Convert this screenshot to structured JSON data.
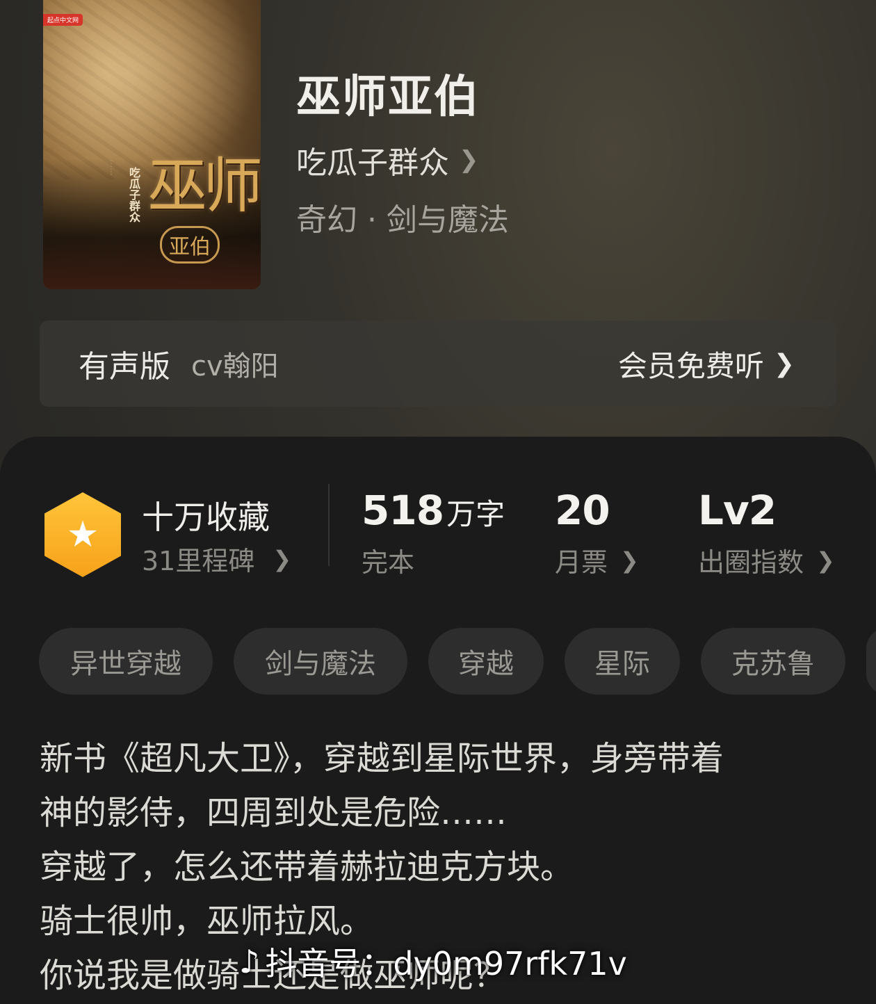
{
  "book": {
    "cover_badge": "起点中文网",
    "cover_title_big": "巫师",
    "cover_title_small": "亚伯",
    "cover_author": "吃瓜子群众",
    "title": "巫师亚伯",
    "author": "吃瓜子群众",
    "genre": "奇幻 · 剑与魔法"
  },
  "audio": {
    "label": "有声版",
    "narrator": "cv翰阳",
    "action": "会员免费听"
  },
  "stats": {
    "collect_title": "十万收藏",
    "collect_sub": "31里程碑",
    "words_number": "518",
    "words_unit": "万字",
    "status": "完本",
    "votes_number": "20",
    "votes_label": "月票",
    "level_number": "Lv2",
    "level_label": "出圈指数"
  },
  "tags": [
    "异世穿越",
    "剑与魔法",
    "穿越",
    "星际",
    "克苏鲁"
  ],
  "description": [
    "新书《超凡大卫》，穿越到星际世界，身旁带着",
    "神的影侍，四周到处是危险……",
    "穿越了，怎么还带着赫拉迪克方块。",
    "骑士很帅，巫师拉风。",
    "你说我是做骑士还是做巫师呢？"
  ],
  "watermark": "抖音号：dy0m97rfk71v",
  "icons": {
    "chevron": "chevron-right-icon",
    "milestone": "star-hexagon-icon",
    "logo": "tiktok-note-icon"
  },
  "colors": {
    "accent_hex": "#f7a21a",
    "panel_bg": "#1b1b1b"
  }
}
